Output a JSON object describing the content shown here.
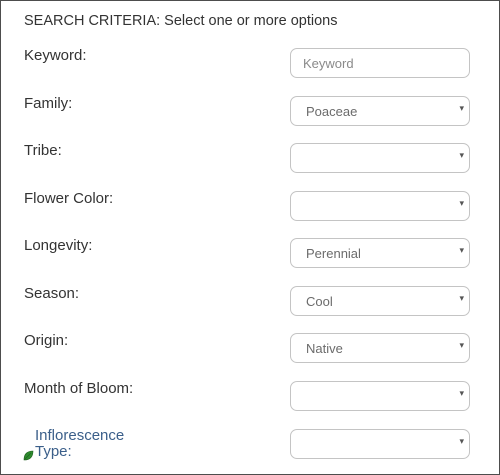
{
  "heading": "SEARCH CRITERIA: Select one or more options",
  "fields": {
    "keyword": {
      "label": "Keyword:",
      "placeholder": "Keyword",
      "value": ""
    },
    "family": {
      "label": "Family:",
      "value": "Poaceae"
    },
    "tribe": {
      "label": "Tribe:",
      "value": ""
    },
    "flower_color": {
      "label": "Flower Color:",
      "value": ""
    },
    "longevity": {
      "label": "Longevity:",
      "value": "Perennial"
    },
    "season": {
      "label": "Season:",
      "value": "Cool"
    },
    "origin": {
      "label": "Origin:",
      "value": "Native"
    },
    "month_of_bloom": {
      "label": "Month of Bloom:",
      "value": ""
    },
    "inflorescence_type": {
      "label_line1": "Inflorescence",
      "label_line2": "Type:",
      "value": ""
    }
  },
  "caret_glyph": "▾",
  "icons": {
    "inflorescence_link": "leaf-icon"
  },
  "colors": {
    "link": "#3b5f8a",
    "leaf": "#2e8b2e"
  }
}
